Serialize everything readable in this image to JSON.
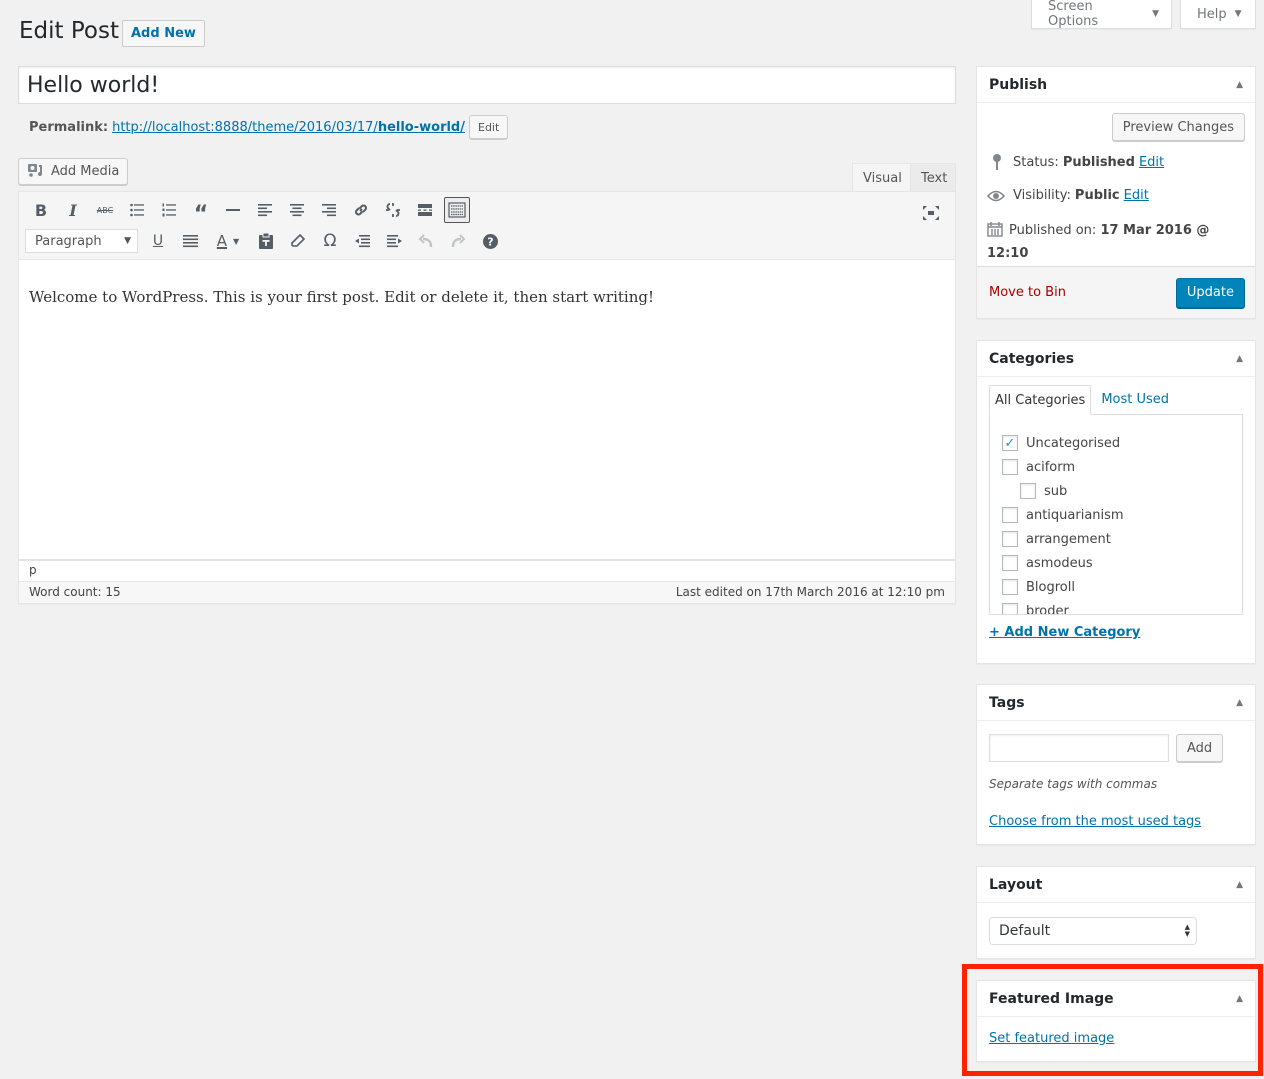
{
  "screen_meta": {
    "screen_options_label": "Screen Options",
    "help_label": "Help"
  },
  "header": {
    "title": "Edit Post",
    "add_new_label": "Add New"
  },
  "post": {
    "title": "Hello world!",
    "permalink_label": "Permalink:",
    "permalink_base": "http://localhost:8888/theme/2016/03/17/",
    "permalink_slug": "hello-world/",
    "permalink_edit_label": "Edit"
  },
  "editor": {
    "add_media_label": "Add Media",
    "tabs": [
      {
        "label": "Visual",
        "active": true
      },
      {
        "label": "Text",
        "active": false
      }
    ],
    "toolbar_row1": [
      "bold-icon",
      "italic-icon",
      "strikethrough-icon",
      "bullet-list-icon",
      "numbered-list-icon",
      "blockquote-icon",
      "horizontal-line-icon",
      "align-left-icon",
      "align-center-icon",
      "align-right-icon",
      "link-icon",
      "unlink-icon",
      "read-more-icon",
      "toolbar-toggle-icon"
    ],
    "toolbar_row2": [
      "underline-icon",
      "justify-icon",
      "text-color-icon",
      "paste-as-text-icon",
      "clear-formatting-icon",
      "special-character-icon",
      "outdent-icon",
      "indent-icon",
      "undo-icon",
      "redo-icon",
      "help-icon"
    ],
    "format_select": "Paragraph",
    "content": "Welcome to WordPress. This is your first post. Edit or delete it, then start writing!",
    "path": "p",
    "word_count_label": "Word count: 15",
    "last_edited": "Last edited on 17th March 2016 at 12:10 pm"
  },
  "publish": {
    "title": "Publish",
    "preview_label": "Preview Changes",
    "status_label": "Status:",
    "status_value": "Published",
    "visibility_label": "Visibility:",
    "visibility_value": "Public",
    "published_label": "Published on:",
    "published_value": "17 Mar 2016 @ 12:10",
    "edit_label": "Edit",
    "trash_label": "Move to Bin",
    "update_label": "Update"
  },
  "categories": {
    "title": "Categories",
    "tab_all": "All Categories",
    "tab_most_used": "Most Used",
    "items": [
      {
        "label": "Uncategorised",
        "checked": true,
        "level": 0
      },
      {
        "label": "aciform",
        "checked": false,
        "level": 0
      },
      {
        "label": "sub",
        "checked": false,
        "level": 1
      },
      {
        "label": "antiquarianism",
        "checked": false,
        "level": 0
      },
      {
        "label": "arrangement",
        "checked": false,
        "level": 0
      },
      {
        "label": "asmodeus",
        "checked": false,
        "level": 0
      },
      {
        "label": "Blogroll",
        "checked": false,
        "level": 0
      },
      {
        "label": "broder",
        "checked": false,
        "level": 0
      }
    ],
    "add_new_label": "+ Add New Category"
  },
  "tags": {
    "title": "Tags",
    "input_value": "",
    "add_label": "Add",
    "hint": "Separate tags with commas",
    "choose_label": "Choose from the most used tags"
  },
  "layout": {
    "title": "Layout",
    "selected": "Default"
  },
  "featured_image": {
    "title": "Featured Image",
    "set_label": "Set featured image"
  },
  "colors": {
    "accent": "#0073aa",
    "primary_button": "#0085ba",
    "trash": "#a00",
    "highlight": "#ff2200"
  }
}
